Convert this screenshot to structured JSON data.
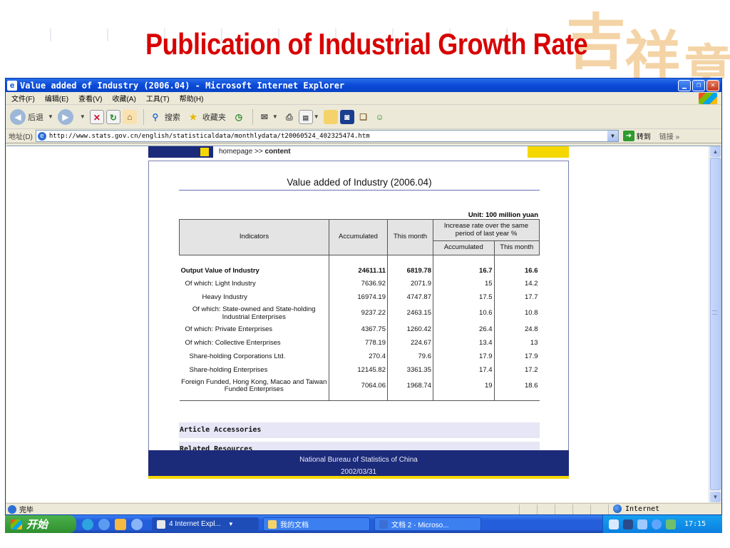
{
  "slide": {
    "title": "Publication of Industrial Growth Rate"
  },
  "window": {
    "title": "Value added of Industry (2006.04) - Microsoft Internet Explorer",
    "menu": [
      "文件(F)",
      "编辑(E)",
      "查看(V)",
      "收藏(A)",
      "工具(T)",
      "帮助(H)"
    ],
    "toolbar": {
      "back": "后退",
      "search": "搜索",
      "favorites": "收藏夹"
    },
    "address": {
      "label": "地址(D)",
      "url": "http://www.stats.gov.cn/english/statisticaldata/monthlydata/t20060524_402325474.htm",
      "go": "转到",
      "links": "链接"
    },
    "status": {
      "text": "完毕",
      "zone": "Internet"
    }
  },
  "page": {
    "breadcrumb_home": "homepage",
    "breadcrumb_sep": ">>",
    "breadcrumb_current": "content",
    "title": "Value added of Industry (2006.04)",
    "unit": "Unit: 100 million yuan",
    "headers": {
      "indicators": "Indicators",
      "accumulated": "Accumulated",
      "this_month": "This month",
      "increase_rate": "Increase rate over the same period of last year %",
      "rate_accumulated": "Accumulated",
      "rate_this_month": "This month"
    },
    "rows": [
      {
        "label": "Output Value of Industry",
        "acc": "24611.11",
        "month": "6819.78",
        "rate_acc": "16.7",
        "rate_month": "16.6"
      },
      {
        "label": "Of which: Light Industry",
        "acc": "7636.92",
        "month": "2071.9",
        "rate_acc": "15",
        "rate_month": "14.2"
      },
      {
        "label": "Heavy Industry",
        "acc": "16974.19",
        "month": "4747.87",
        "rate_acc": "17.5",
        "rate_month": "17.7"
      },
      {
        "label": "Of which: State-owned and State-holding Industrial Enterprises",
        "acc": "9237.22",
        "month": "2463.15",
        "rate_acc": "10.6",
        "rate_month": "10.8"
      },
      {
        "label": "Of which: Private Enterprises",
        "acc": "4367.75",
        "month": "1260.42",
        "rate_acc": "26.4",
        "rate_month": "24.8"
      },
      {
        "label": "Of which: Collective Enterprises",
        "acc": "778.19",
        "month": "224.67",
        "rate_acc": "13.4",
        "rate_month": "13"
      },
      {
        "label": "Share-holding Corporations Ltd.",
        "acc": "270.4",
        "month": "79.6",
        "rate_acc": "17.9",
        "rate_month": "17.9"
      },
      {
        "label": "Share-holding Enterprises",
        "acc": "12145.82",
        "month": "3361.35",
        "rate_acc": "17.4",
        "rate_month": "17.2"
      },
      {
        "label": "Foreign Funded, Hong Kong, Macao and Taiwan Funded Enterprises",
        "acc": "7064.06",
        "month": "1968.74",
        "rate_acc": "19",
        "rate_month": "18.6"
      }
    ],
    "article_accessories": "Article Accessories",
    "related_resources": "Related Resources",
    "footer_org": "National Bureau of Statistics of China",
    "footer_date": "2002/03/31"
  },
  "taskbar": {
    "start": "开始",
    "tasks": [
      "4 Internet Expl...",
      "我的文档",
      "文档 2 - Microso..."
    ],
    "clock": "17:15"
  }
}
